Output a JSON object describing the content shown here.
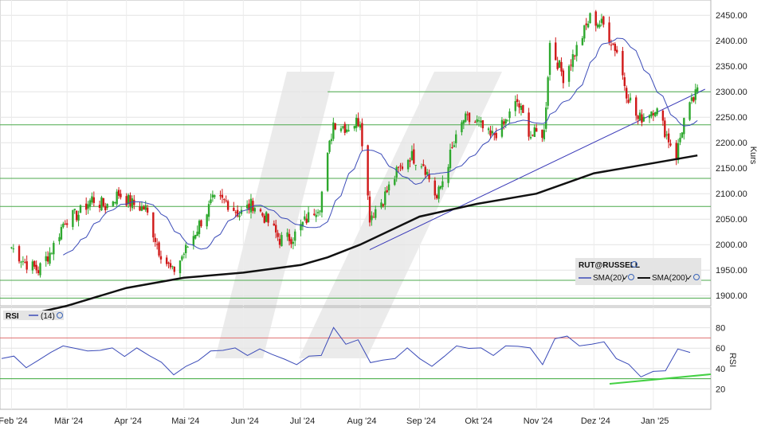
{
  "chart_data": [
    {
      "type": "candlestick",
      "symbol": "RUT@RUSSELL",
      "ylabel": "Kurs",
      "ylim": [
        1880,
        2480
      ],
      "yticks": [
        "1900.00",
        "1950.00",
        "2000.00",
        "2050.00",
        "2100.00",
        "2150.00",
        "2200.00",
        "2250.00",
        "2300.00",
        "2350.00",
        "2400.00",
        "2450.00"
      ],
      "x_categories": [
        "Feb '24",
        "Mär '24",
        "Apr '24",
        "Mai '24",
        "Jun '24",
        "Jul '24",
        "Aug '24",
        "Sep '24",
        "Okt '24",
        "Nov '24",
        "Dez '24",
        "Jan '25"
      ],
      "legend": [
        {
          "name": "SMA(20)",
          "color": "#3b4bb8"
        },
        {
          "name": "SMA(200)",
          "color": "#111111"
        }
      ],
      "close_series": [
        [
          "2024-02-01",
          1995
        ],
        [
          "2024-02-08",
          1965
        ],
        [
          "2024-02-15",
          1950
        ],
        [
          "2024-02-22",
          1990
        ],
        [
          "2024-02-29",
          2050
        ],
        [
          "2024-03-07",
          2060
        ],
        [
          "2024-03-14",
          2090
        ],
        [
          "2024-03-21",
          2075
        ],
        [
          "2024-03-28",
          2100
        ],
        [
          "2024-04-04",
          2080
        ],
        [
          "2024-04-11",
          2070
        ],
        [
          "2024-04-18",
          1990
        ],
        [
          "2024-04-25",
          1945
        ],
        [
          "2024-05-02",
          1990
        ],
        [
          "2024-05-09",
          2040
        ],
        [
          "2024-05-16",
          2085
        ],
        [
          "2024-05-23",
          2085
        ],
        [
          "2024-05-30",
          2060
        ],
        [
          "2024-06-06",
          2080
        ],
        [
          "2024-06-13",
          2050
        ],
        [
          "2024-06-20",
          2010
        ],
        [
          "2024-06-27",
          2015
        ],
        [
          "2024-07-04",
          2050
        ],
        [
          "2024-07-11",
          2080
        ],
        [
          "2024-07-18",
          2240
        ],
        [
          "2024-07-25",
          2230
        ],
        [
          "2024-08-01",
          2245
        ],
        [
          "2024-08-06",
          2055
        ],
        [
          "2024-08-13",
          2090
        ],
        [
          "2024-08-20",
          2140
        ],
        [
          "2024-08-27",
          2175
        ],
        [
          "2024-09-03",
          2160
        ],
        [
          "2024-09-10",
          2090
        ],
        [
          "2024-09-17",
          2175
        ],
        [
          "2024-09-24",
          2245
        ],
        [
          "2024-10-01",
          2240
        ],
        [
          "2024-10-08",
          2210
        ],
        [
          "2024-10-15",
          2235
        ],
        [
          "2024-10-22",
          2280
        ],
        [
          "2024-10-29",
          2215
        ],
        [
          "2024-11-05",
          2220
        ],
        [
          "2024-11-08",
          2395
        ],
        [
          "2024-11-15",
          2330
        ],
        [
          "2024-11-22",
          2385
        ],
        [
          "2024-11-29",
          2445
        ],
        [
          "2024-12-06",
          2430
        ],
        [
          "2024-12-13",
          2380
        ],
        [
          "2024-12-18",
          2300
        ],
        [
          "2024-12-24",
          2245
        ],
        [
          "2025-01-02",
          2270
        ],
        [
          "2025-01-08",
          2215
        ],
        [
          "2025-01-13",
          2175
        ],
        [
          "2025-01-17",
          2245
        ],
        [
          "2025-01-24",
          2300
        ]
      ],
      "sma200": [
        [
          "2024-02-01",
          1855
        ],
        [
          "2024-03-01",
          1880
        ],
        [
          "2024-04-01",
          1915
        ],
        [
          "2024-05-01",
          1935
        ],
        [
          "2024-06-01",
          1945
        ],
        [
          "2024-07-01",
          1960
        ],
        [
          "2024-07-15",
          1975
        ],
        [
          "2024-08-01",
          2000
        ],
        [
          "2024-09-01",
          2055
        ],
        [
          "2024-10-01",
          2080
        ],
        [
          "2024-11-01",
          2100
        ],
        [
          "2024-12-01",
          2140
        ],
        [
          "2025-01-01",
          2160
        ],
        [
          "2025-01-24",
          2175
        ]
      ],
      "horizontal_levels": [
        1895,
        1930,
        2075,
        2130,
        2235,
        2300
      ],
      "trendline": [
        [
          "2024-08-06",
          1990
        ],
        [
          "2025-01-28",
          2305
        ]
      ]
    },
    {
      "type": "line",
      "indicator": "RSI",
      "params": "(14)",
      "ylabel": "RSI",
      "ylim": [
        0,
        100
      ],
      "yticks": [
        20,
        40,
        60,
        80
      ],
      "levels": [
        30,
        70
      ],
      "values": [
        52,
        50,
        43,
        46,
        58,
        60,
        62,
        55,
        60,
        58,
        54,
        58,
        55,
        44,
        36,
        40,
        50,
        55,
        60,
        58,
        55,
        57,
        56,
        47,
        46,
        50,
        55,
        78,
        66,
        66,
        48,
        46,
        52,
        58,
        52,
        40,
        54,
        60,
        62,
        58,
        55,
        60,
        64,
        58,
        46,
        67,
        74,
        60,
        66,
        64,
        52,
        42,
        34,
        35,
        40,
        57,
        58
      ]
    }
  ]
}
